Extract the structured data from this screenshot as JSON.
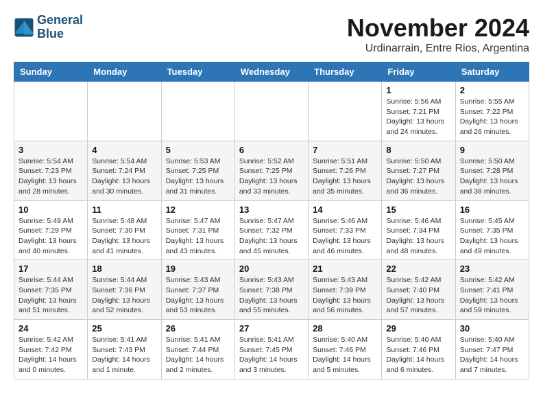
{
  "logo": {
    "line1": "General",
    "line2": "Blue"
  },
  "title": "November 2024",
  "location": "Urdinarrain, Entre Rios, Argentina",
  "weekdays": [
    "Sunday",
    "Monday",
    "Tuesday",
    "Wednesday",
    "Thursday",
    "Friday",
    "Saturday"
  ],
  "weeks": [
    [
      {
        "day": "",
        "info": ""
      },
      {
        "day": "",
        "info": ""
      },
      {
        "day": "",
        "info": ""
      },
      {
        "day": "",
        "info": ""
      },
      {
        "day": "",
        "info": ""
      },
      {
        "day": "1",
        "info": "Sunrise: 5:56 AM\nSunset: 7:21 PM\nDaylight: 13 hours\nand 24 minutes."
      },
      {
        "day": "2",
        "info": "Sunrise: 5:55 AM\nSunset: 7:22 PM\nDaylight: 13 hours\nand 26 minutes."
      }
    ],
    [
      {
        "day": "3",
        "info": "Sunrise: 5:54 AM\nSunset: 7:23 PM\nDaylight: 13 hours\nand 28 minutes."
      },
      {
        "day": "4",
        "info": "Sunrise: 5:54 AM\nSunset: 7:24 PM\nDaylight: 13 hours\nand 30 minutes."
      },
      {
        "day": "5",
        "info": "Sunrise: 5:53 AM\nSunset: 7:25 PM\nDaylight: 13 hours\nand 31 minutes."
      },
      {
        "day": "6",
        "info": "Sunrise: 5:52 AM\nSunset: 7:25 PM\nDaylight: 13 hours\nand 33 minutes."
      },
      {
        "day": "7",
        "info": "Sunrise: 5:51 AM\nSunset: 7:26 PM\nDaylight: 13 hours\nand 35 minutes."
      },
      {
        "day": "8",
        "info": "Sunrise: 5:50 AM\nSunset: 7:27 PM\nDaylight: 13 hours\nand 36 minutes."
      },
      {
        "day": "9",
        "info": "Sunrise: 5:50 AM\nSunset: 7:28 PM\nDaylight: 13 hours\nand 38 minutes."
      }
    ],
    [
      {
        "day": "10",
        "info": "Sunrise: 5:49 AM\nSunset: 7:29 PM\nDaylight: 13 hours\nand 40 minutes."
      },
      {
        "day": "11",
        "info": "Sunrise: 5:48 AM\nSunset: 7:30 PM\nDaylight: 13 hours\nand 41 minutes."
      },
      {
        "day": "12",
        "info": "Sunrise: 5:47 AM\nSunset: 7:31 PM\nDaylight: 13 hours\nand 43 minutes."
      },
      {
        "day": "13",
        "info": "Sunrise: 5:47 AM\nSunset: 7:32 PM\nDaylight: 13 hours\nand 45 minutes."
      },
      {
        "day": "14",
        "info": "Sunrise: 5:46 AM\nSunset: 7:33 PM\nDaylight: 13 hours\nand 46 minutes."
      },
      {
        "day": "15",
        "info": "Sunrise: 5:46 AM\nSunset: 7:34 PM\nDaylight: 13 hours\nand 48 minutes."
      },
      {
        "day": "16",
        "info": "Sunrise: 5:45 AM\nSunset: 7:35 PM\nDaylight: 13 hours\nand 49 minutes."
      }
    ],
    [
      {
        "day": "17",
        "info": "Sunrise: 5:44 AM\nSunset: 7:35 PM\nDaylight: 13 hours\nand 51 minutes."
      },
      {
        "day": "18",
        "info": "Sunrise: 5:44 AM\nSunset: 7:36 PM\nDaylight: 13 hours\nand 52 minutes."
      },
      {
        "day": "19",
        "info": "Sunrise: 5:43 AM\nSunset: 7:37 PM\nDaylight: 13 hours\nand 53 minutes."
      },
      {
        "day": "20",
        "info": "Sunrise: 5:43 AM\nSunset: 7:38 PM\nDaylight: 13 hours\nand 55 minutes."
      },
      {
        "day": "21",
        "info": "Sunrise: 5:43 AM\nSunset: 7:39 PM\nDaylight: 13 hours\nand 56 minutes."
      },
      {
        "day": "22",
        "info": "Sunrise: 5:42 AM\nSunset: 7:40 PM\nDaylight: 13 hours\nand 57 minutes."
      },
      {
        "day": "23",
        "info": "Sunrise: 5:42 AM\nSunset: 7:41 PM\nDaylight: 13 hours\nand 59 minutes."
      }
    ],
    [
      {
        "day": "24",
        "info": "Sunrise: 5:42 AM\nSunset: 7:42 PM\nDaylight: 14 hours\nand 0 minutes."
      },
      {
        "day": "25",
        "info": "Sunrise: 5:41 AM\nSunset: 7:43 PM\nDaylight: 14 hours\nand 1 minute."
      },
      {
        "day": "26",
        "info": "Sunrise: 5:41 AM\nSunset: 7:44 PM\nDaylight: 14 hours\nand 2 minutes."
      },
      {
        "day": "27",
        "info": "Sunrise: 5:41 AM\nSunset: 7:45 PM\nDaylight: 14 hours\nand 3 minutes."
      },
      {
        "day": "28",
        "info": "Sunrise: 5:40 AM\nSunset: 7:46 PM\nDaylight: 14 hours\nand 5 minutes."
      },
      {
        "day": "29",
        "info": "Sunrise: 5:40 AM\nSunset: 7:46 PM\nDaylight: 14 hours\nand 6 minutes."
      },
      {
        "day": "30",
        "info": "Sunrise: 5:40 AM\nSunset: 7:47 PM\nDaylight: 14 hours\nand 7 minutes."
      }
    ]
  ]
}
